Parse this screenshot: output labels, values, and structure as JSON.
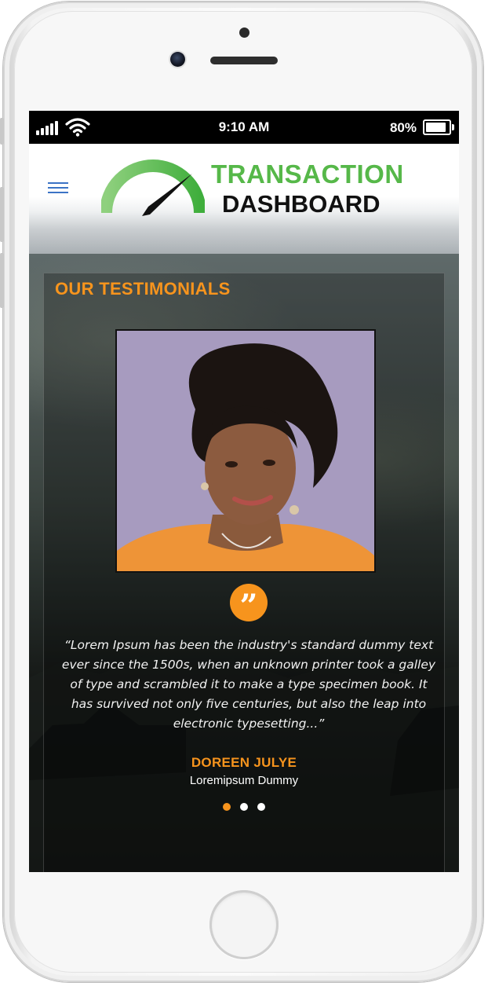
{
  "status_bar": {
    "time": "9:10 AM",
    "battery": "80%"
  },
  "header": {
    "logo_line1": "TRANSACTION",
    "logo_line2": "DASHBOARD"
  },
  "testimonials": {
    "title": "OUR TESTIMONIALS",
    "quote_mark": "”",
    "quote": "“Lorem Ipsum has been the industry's standard dummy text ever since the 1500s, when an unknown printer took a galley of type and scrambled it to make a type specimen book. It has survived not only five centuries, but also the leap into electronic typesetting...”",
    "author": "DOREEN JULYE",
    "author_role": "Loremipsum Dummy",
    "slide_count": 3,
    "active_slide": 1
  },
  "colors": {
    "accent": "#f7941d",
    "logo_green": "#56b849",
    "menu_blue": "#3b73c5"
  },
  "icons": [
    "menu-icon",
    "signal-icon",
    "wifi-icon",
    "battery-icon",
    "gauge-logo-icon",
    "quote-icon"
  ]
}
